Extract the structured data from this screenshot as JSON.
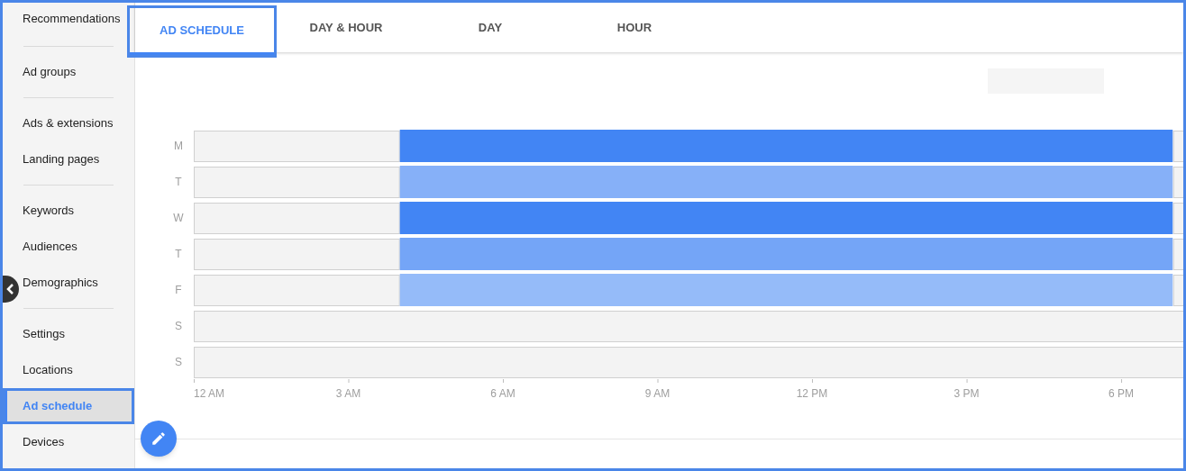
{
  "sidebar": {
    "groups": [
      {
        "items": [
          {
            "label": "Recommendations",
            "selected": false
          }
        ]
      },
      {
        "items": [
          {
            "label": "Ad groups",
            "selected": false
          }
        ]
      },
      {
        "items": [
          {
            "label": "Ads & extensions",
            "selected": false
          },
          {
            "label": "Landing pages",
            "selected": false
          }
        ]
      },
      {
        "items": [
          {
            "label": "Keywords",
            "selected": false
          },
          {
            "label": "Audiences",
            "selected": false
          },
          {
            "label": "Demographics",
            "selected": false
          }
        ]
      },
      {
        "items": [
          {
            "label": "Settings",
            "selected": false
          },
          {
            "label": "Locations",
            "selected": false
          },
          {
            "label": "Ad schedule",
            "selected": true
          },
          {
            "label": "Devices",
            "selected": false
          }
        ]
      }
    ]
  },
  "tabs": [
    {
      "label": "AD SCHEDULE",
      "selected": true
    },
    {
      "label": "DAY & HOUR",
      "selected": false
    },
    {
      "label": "DAY",
      "selected": false
    },
    {
      "label": "HOUR",
      "selected": false
    }
  ],
  "schedule": {
    "days": [
      {
        "label": "M",
        "color": "#4285f4"
      },
      {
        "label": "T",
        "color": "#86b0f8"
      },
      {
        "label": "W",
        "color": "#4285f4"
      },
      {
        "label": "T",
        "color": "#74a5f7"
      },
      {
        "label": "F",
        "color": "#95bbf9"
      },
      {
        "label": "S"
      },
      {
        "label": "S"
      }
    ],
    "time_labels": [
      "12 AM",
      "3 AM",
      "6 AM",
      "9 AM",
      "12 PM",
      "3 PM",
      "6 PM"
    ]
  }
}
